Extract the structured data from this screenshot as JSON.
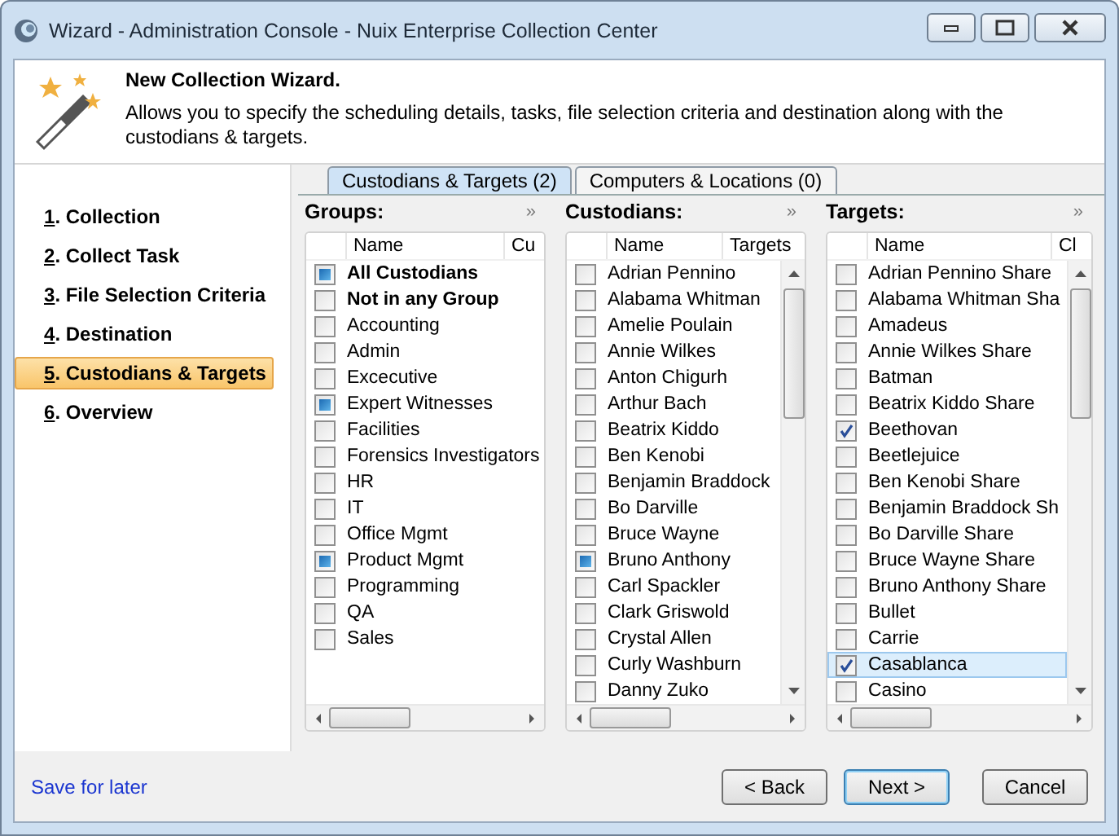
{
  "window": {
    "title": "Wizard - Administration Console - Nuix Enterprise Collection Center"
  },
  "header": {
    "title": "New Collection Wizard.",
    "description": "Allows you to specify the scheduling details, tasks, file selection criteria and destination along with the custodians & targets."
  },
  "steps": [
    {
      "mnemonic": "1",
      "label": ". Collection",
      "selected": false
    },
    {
      "mnemonic": "2",
      "label": ". Collect Task",
      "selected": false
    },
    {
      "mnemonic": "3",
      "label": ". File Selection Criteria",
      "selected": false
    },
    {
      "mnemonic": "4",
      "label": ". Destination",
      "selected": false
    },
    {
      "mnemonic": "5",
      "label": ". Custodians & Targets",
      "selected": true
    },
    {
      "mnemonic": "6",
      "label": ". Overview",
      "selected": false
    }
  ],
  "tabs": [
    {
      "label": "Custodians & Targets (2)",
      "selected": true
    },
    {
      "label": "Computers & Locations (0)",
      "selected": false
    }
  ],
  "panels": [
    {
      "title": "Groups:",
      "expand": "»",
      "kind": "square",
      "columns": [
        "Name",
        "Cu"
      ],
      "items": [
        {
          "name": "All Custodians",
          "bold": true,
          "checked": true
        },
        {
          "name": "Not in any Group",
          "bold": true,
          "checked": false
        },
        {
          "name": "Accounting",
          "bold": false,
          "checked": false
        },
        {
          "name": "Admin",
          "bold": false,
          "checked": false
        },
        {
          "name": "Excecutive",
          "bold": false,
          "checked": false
        },
        {
          "name": "Expert Witnesses",
          "bold": false,
          "checked": true
        },
        {
          "name": "Facilities",
          "bold": false,
          "checked": false
        },
        {
          "name": "Forensics Investigators",
          "bold": false,
          "checked": false
        },
        {
          "name": "HR",
          "bold": false,
          "checked": false
        },
        {
          "name": "IT",
          "bold": false,
          "checked": false
        },
        {
          "name": "Office Mgmt",
          "bold": false,
          "checked": false
        },
        {
          "name": "Product Mgmt",
          "bold": false,
          "checked": true
        },
        {
          "name": "Programming",
          "bold": false,
          "checked": false
        },
        {
          "name": "QA",
          "bold": false,
          "checked": false
        },
        {
          "name": "Sales",
          "bold": false,
          "checked": false
        }
      ]
    },
    {
      "title": "Custodians:",
      "expand": "»",
      "kind": "square",
      "columns": [
        "Name",
        "Targets"
      ],
      "items": [
        {
          "name": "Adrian Pennino",
          "checked": false
        },
        {
          "name": "Alabama Whitman",
          "checked": false
        },
        {
          "name": "Amelie Poulain",
          "checked": false
        },
        {
          "name": "Annie Wilkes",
          "checked": false
        },
        {
          "name": "Anton Chigurh",
          "checked": false
        },
        {
          "name": "Arthur Bach",
          "checked": false
        },
        {
          "name": "Beatrix Kiddo",
          "checked": false
        },
        {
          "name": "Ben Kenobi",
          "checked": false
        },
        {
          "name": "Benjamin Braddock",
          "checked": false
        },
        {
          "name": "Bo Darville",
          "checked": false
        },
        {
          "name": "Bruce Wayne",
          "checked": false
        },
        {
          "name": "Bruno Anthony",
          "checked": true
        },
        {
          "name": "Carl Spackler",
          "checked": false
        },
        {
          "name": "Clark Griswold",
          "checked": false
        },
        {
          "name": "Crystal Allen",
          "checked": false
        },
        {
          "name": "Curly Washburn",
          "checked": false
        },
        {
          "name": "Danny Zuko",
          "checked": false
        }
      ]
    },
    {
      "title": "Targets:",
      "expand": "»",
      "kind": "tick",
      "columns": [
        "Name",
        "Cl"
      ],
      "items": [
        {
          "name": "Adrian Pennino Share",
          "checked": false,
          "selected": false
        },
        {
          "name": "Alabama Whitman Sha",
          "checked": false,
          "selected": false
        },
        {
          "name": "Amadeus",
          "checked": false,
          "selected": false
        },
        {
          "name": "Annie Wilkes Share",
          "checked": false,
          "selected": false
        },
        {
          "name": "Batman",
          "checked": false,
          "selected": false
        },
        {
          "name": "Beatrix Kiddo Share",
          "checked": false,
          "selected": false
        },
        {
          "name": "Beethovan",
          "checked": true,
          "selected": false
        },
        {
          "name": "Beetlejuice",
          "checked": false,
          "selected": false
        },
        {
          "name": "Ben Kenobi Share",
          "checked": false,
          "selected": false
        },
        {
          "name": "Benjamin Braddock Sh",
          "checked": false,
          "selected": false
        },
        {
          "name": "Bo Darville Share",
          "checked": false,
          "selected": false
        },
        {
          "name": "Bruce Wayne Share",
          "checked": false,
          "selected": false
        },
        {
          "name": "Bruno Anthony Share",
          "checked": false,
          "selected": false
        },
        {
          "name": "Bullet",
          "checked": false,
          "selected": false
        },
        {
          "name": "Carrie",
          "checked": false,
          "selected": false
        },
        {
          "name": "Casablanca",
          "checked": true,
          "selected": true
        },
        {
          "name": "Casino",
          "checked": false,
          "selected": false
        }
      ]
    }
  ],
  "footer": {
    "link": "Save for later",
    "buttons": [
      {
        "label": "< Back",
        "default": false
      },
      {
        "label": "Next >",
        "default": true
      },
      {
        "label": "Cancel",
        "default": false
      }
    ]
  }
}
